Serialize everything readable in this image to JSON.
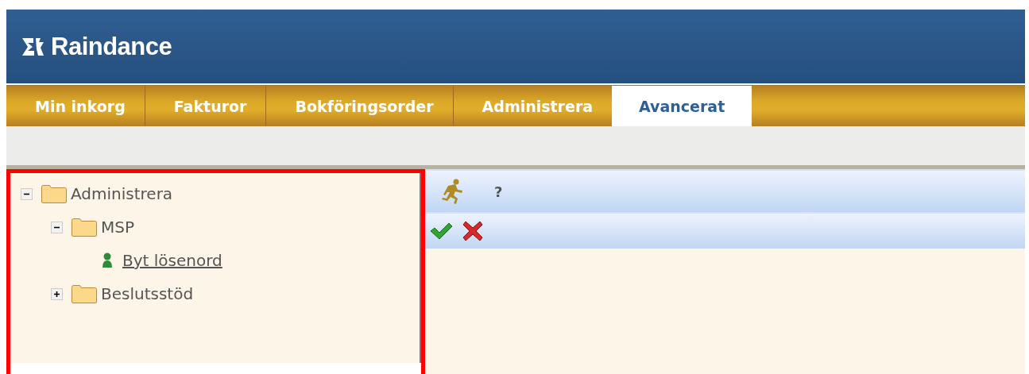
{
  "header": {
    "logo": "Raindance"
  },
  "tabs": [
    {
      "label": "Min inkorg",
      "selected": false
    },
    {
      "label": "Fakturor",
      "selected": false
    },
    {
      "label": "Bokföringsorder",
      "selected": false
    },
    {
      "label": "Administrera",
      "selected": false
    },
    {
      "label": "Avancerat",
      "selected": true
    }
  ],
  "tree": [
    {
      "kind": "folder",
      "label": "Administrera",
      "expanded": true,
      "children": [
        {
          "kind": "folder",
          "label": "MSP",
          "expanded": true,
          "children": [
            {
              "kind": "link",
              "label": "Byt lösenord"
            }
          ]
        },
        {
          "kind": "folder",
          "label": "Beslutsstöd",
          "expanded": false
        }
      ]
    }
  ],
  "toolbar": {
    "help": "?"
  }
}
